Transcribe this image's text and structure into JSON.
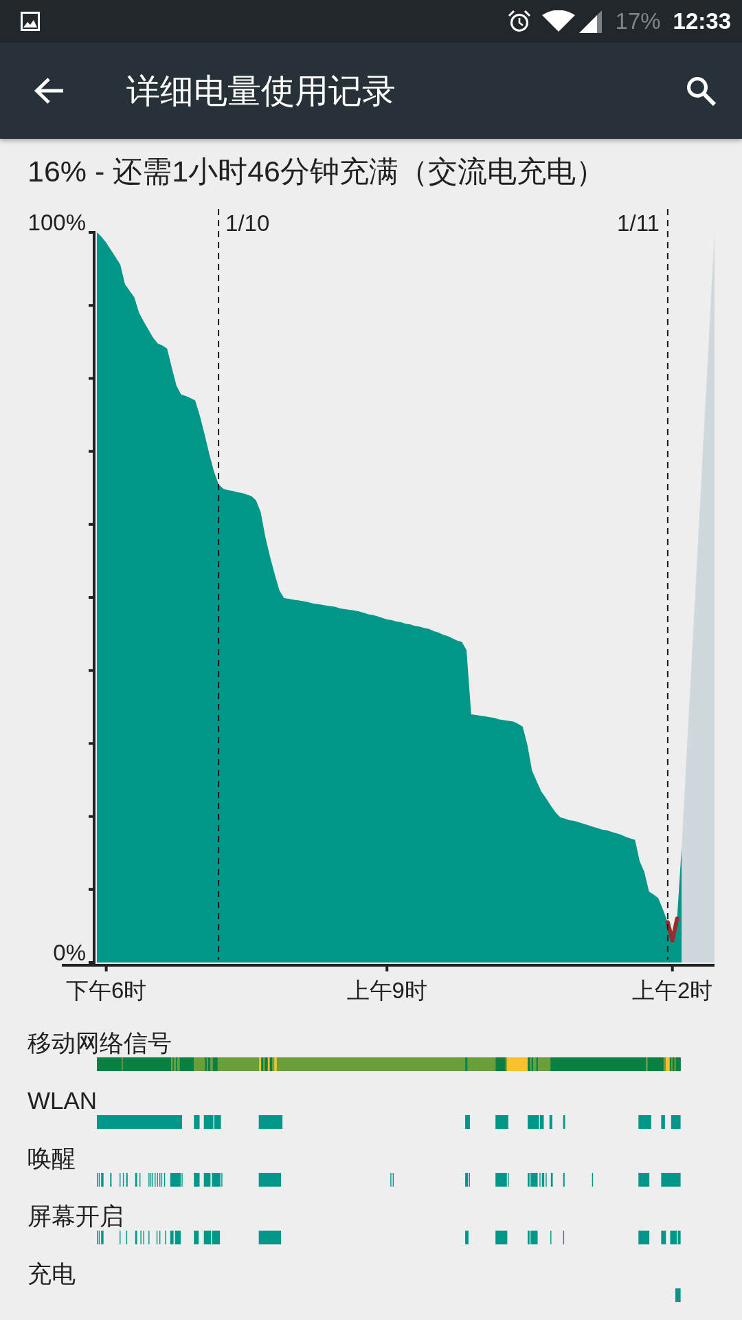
{
  "status_bar": {
    "battery": "17%",
    "time": "12:33"
  },
  "app_bar": {
    "title": "详细电量使用记录"
  },
  "summary": "16% - 还需1小时46分钟充满（交流电充电）",
  "battery_chart": {
    "chart_data": {
      "type": "area",
      "categories": [
        null,
        null,
        "下午6时",
        null,
        null,
        null,
        null,
        null,
        null,
        null,
        null,
        null,
        null,
        null,
        null,
        null,
        null,
        null,
        null,
        null,
        null,
        null,
        null,
        null,
        null,
        null,
        null,
        null,
        null,
        null,
        null,
        null,
        null,
        null,
        null,
        null,
        null,
        null,
        null,
        null,
        null,
        null,
        null,
        null,
        null,
        null,
        null,
        null,
        null,
        null,
        null,
        null,
        null,
        null,
        null,
        null,
        null,
        null,
        null,
        null,
        null,
        null,
        "上午9时",
        null,
        null,
        null,
        null,
        null,
        null,
        null,
        null,
        null,
        null,
        null,
        null,
        null,
        null,
        null,
        null,
        null,
        null,
        null,
        null,
        null,
        null,
        null,
        null,
        null,
        null,
        null,
        null,
        null,
        null,
        null,
        null,
        null,
        null,
        null,
        null,
        null,
        null,
        null,
        null,
        null,
        null,
        null,
        null,
        null,
        null,
        null,
        null,
        null,
        null,
        null,
        null,
        null,
        null,
        null,
        null,
        null,
        null,
        null,
        null,
        "上午2时",
        null,
        null,
        null,
        null,
        null,
        null,
        null,
        null,
        null
      ],
      "series": [
        {
          "color": "#009688",
          "values": [
            100,
            99.4,
            98.6,
            97.6,
            96.6,
            95.6,
            92.9,
            92.0,
            91.1,
            89.0,
            87.8,
            86.7,
            85.6,
            84.8,
            84.5,
            84.1,
            81.5,
            79.0,
            77.8,
            77.6,
            77.3,
            77,
            74.9,
            72.4,
            69.7,
            67.3,
            65.5,
            64.9,
            64.7,
            64.6,
            64.4,
            64.3,
            64.1,
            63.9,
            63.3,
            61.7,
            58.3,
            55.6,
            53.2,
            51.0,
            49.9,
            49.8,
            49.7,
            49.6,
            49.5,
            49.4,
            49.2,
            49.1,
            49.0,
            48.9,
            48.8,
            48.7,
            48.5,
            48.4,
            48.3,
            48.2,
            48.1,
            47.9,
            47.7,
            47.6,
            47.4,
            47.2,
            47,
            46.9,
            46.7,
            46.6,
            46.4,
            46.3,
            46.1,
            46.0,
            45.8,
            45.7,
            45.4,
            45.2,
            44.9,
            44.7,
            44.4,
            44.1,
            43.9,
            42.8,
            34.0,
            33.9,
            33.8,
            33.7,
            33.6,
            33.5,
            33.3,
            33.2,
            33.1,
            33.0,
            32.7,
            32.3,
            29.8,
            26.3,
            24.8,
            23.4,
            22.5,
            21.5,
            20.6,
            19.9,
            19.7,
            19.5,
            19.4,
            19.2,
            19.0,
            18.8,
            18.6,
            18.4,
            18.2,
            18.1,
            17.9,
            17.7,
            17.5,
            17.2,
            17.0,
            16.8,
            13.9,
            12.4,
            9.7,
            9.3,
            8.8,
            7.2,
            5.5,
            3,
            6,
            16,
            null,
            null,
            null,
            null,
            null,
            null,
            null
          ]
        },
        {
          "type": "line",
          "color": "#992d2d",
          "values": [
            null,
            null,
            null,
            null,
            null,
            null,
            null,
            null,
            null,
            null,
            null,
            null,
            null,
            null,
            null,
            null,
            null,
            null,
            null,
            null,
            null,
            null,
            null,
            null,
            null,
            null,
            null,
            null,
            null,
            null,
            null,
            null,
            null,
            null,
            null,
            null,
            null,
            null,
            null,
            null,
            null,
            null,
            null,
            null,
            null,
            null,
            null,
            null,
            null,
            null,
            null,
            null,
            null,
            null,
            null,
            null,
            null,
            null,
            null,
            null,
            null,
            null,
            null,
            null,
            null,
            null,
            null,
            null,
            null,
            null,
            null,
            null,
            null,
            null,
            null,
            null,
            null,
            null,
            null,
            null,
            null,
            null,
            null,
            null,
            null,
            null,
            null,
            null,
            null,
            null,
            null,
            null,
            null,
            null,
            null,
            null,
            null,
            null,
            null,
            null,
            null,
            null,
            null,
            null,
            null,
            null,
            null,
            null,
            null,
            null,
            null,
            null,
            null,
            null,
            null,
            null,
            null,
            null,
            null,
            null,
            null,
            null,
            5.5,
            3,
            6,
            null,
            null,
            null,
            null,
            null,
            null,
            null,
            null
          ]
        },
        {
          "color": "#cfd8dc",
          "values": [
            null,
            null,
            null,
            null,
            null,
            null,
            null,
            null,
            null,
            null,
            null,
            null,
            null,
            null,
            null,
            null,
            null,
            null,
            null,
            null,
            null,
            null,
            null,
            null,
            null,
            null,
            null,
            null,
            null,
            null,
            null,
            null,
            null,
            null,
            null,
            null,
            null,
            null,
            null,
            null,
            null,
            null,
            null,
            null,
            null,
            null,
            null,
            null,
            null,
            null,
            null,
            null,
            null,
            null,
            null,
            null,
            null,
            null,
            null,
            null,
            null,
            null,
            null,
            null,
            null,
            null,
            null,
            null,
            null,
            null,
            null,
            null,
            null,
            null,
            null,
            null,
            null,
            null,
            null,
            null,
            null,
            null,
            null,
            null,
            null,
            null,
            null,
            null,
            null,
            null,
            null,
            null,
            null,
            null,
            null,
            null,
            null,
            null,
            null,
            null,
            null,
            null,
            null,
            null,
            null,
            null,
            null,
            null,
            null,
            null,
            null,
            null,
            null,
            null,
            null,
            null,
            null,
            null,
            null,
            null,
            null,
            null,
            null,
            null,
            null,
            16,
            28,
            40,
            52,
            64,
            76,
            88,
            100
          ]
        }
      ],
      "ylim": [
        0,
        100
      ],
      "yticks": [
        {
          "value": 0,
          "label": "0%"
        },
        {
          "value": 100,
          "label": "100%"
        }
      ],
      "annotations": [
        "1/10",
        "1/11"
      ]
    }
  },
  "tracks": [
    {
      "label": "移动网络信号",
      "kind": "signal"
    },
    {
      "label": "WLAN",
      "kind": "wlan"
    },
    {
      "label": "唤醒",
      "kind": "awake"
    },
    {
      "label": "屏幕开启",
      "kind": "screen"
    },
    {
      "label": "充电",
      "kind": "charging"
    }
  ]
}
